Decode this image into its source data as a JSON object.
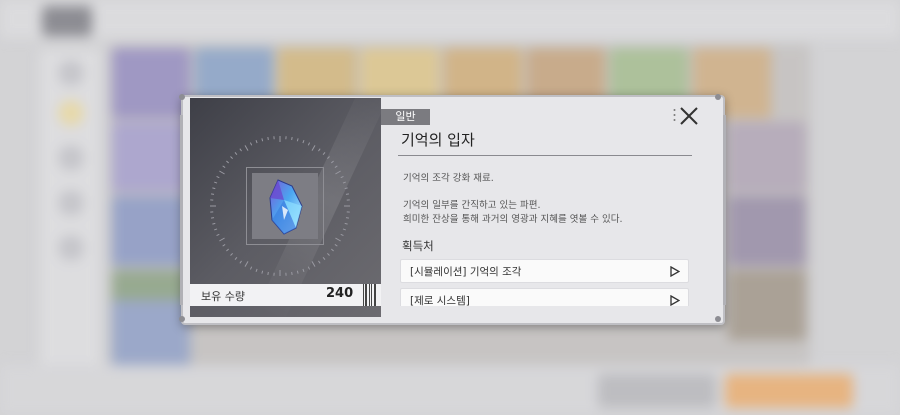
{
  "item": {
    "grade_tag": "일반",
    "name": "기억의 입자",
    "description_line1": "기억의 조각 강화 재료.",
    "description_line2": "기억의 일부를 간직하고 있는 파편.",
    "description_line3": "희미한 잔상을 통해 과거의 영광과 지혜를 엿볼 수 있다.",
    "owned_label": "보유 수량",
    "owned_value": "240",
    "icon": "blue-crystal-icon"
  },
  "acquisition": {
    "title": "획득처",
    "sources": [
      {
        "label": "[시뮬레이션] 기억의 조각"
      },
      {
        "label": "[제로 시스템]"
      }
    ]
  },
  "colors": {
    "tag_bg": "#7b7b80",
    "dialog_bg": "#e7e7ea",
    "item_panel_bg": "#4a4a52",
    "accent_orange": "#e89a4a"
  }
}
